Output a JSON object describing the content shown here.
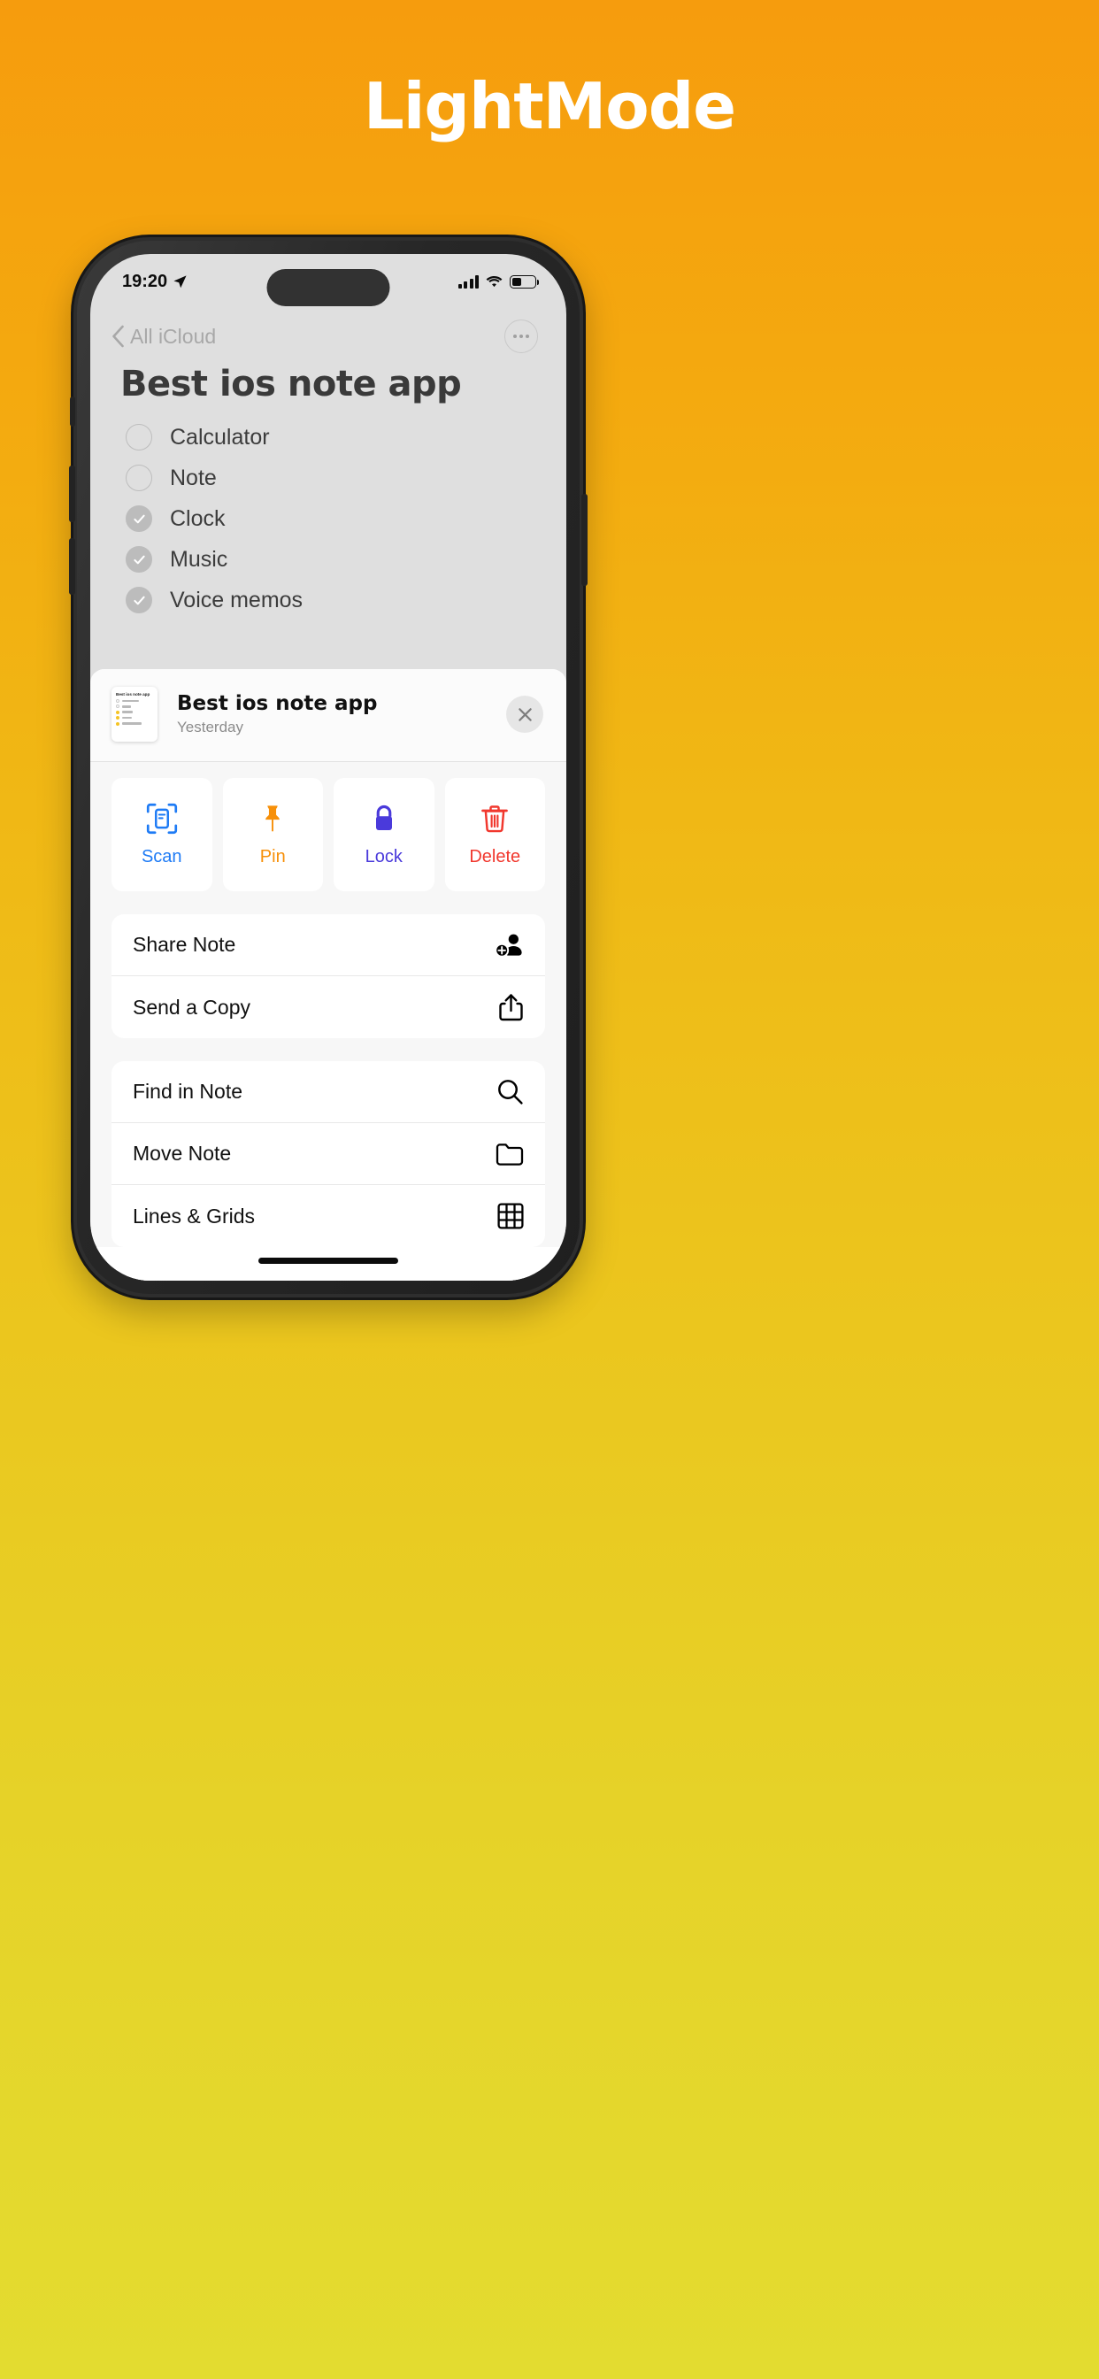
{
  "headline": "LightMode",
  "background": {
    "top_color": "#F69C0D",
    "bottom_color": "#E3DC30"
  },
  "statusbar": {
    "time": "19:20",
    "location_icon": "location-arrow-icon",
    "signal_icon": "cellular-bars-icon",
    "wifi_icon": "wifi-icon",
    "battery_icon": "battery-icon",
    "battery_level": "42%"
  },
  "navbar": {
    "back_label": "All iCloud",
    "back_icon": "chevron-left-icon",
    "more_icon": "ellipsis-circle-icon"
  },
  "note": {
    "title": "Best ios note app",
    "checklist": [
      {
        "label": "Calculator",
        "checked": false
      },
      {
        "label": "Note",
        "checked": false
      },
      {
        "label": "Clock",
        "checked": true
      },
      {
        "label": "Music",
        "checked": true
      },
      {
        "label": "Voice memos",
        "checked": true
      }
    ]
  },
  "sheet": {
    "header": {
      "title": "Best ios note app",
      "subtitle": "Yesterday",
      "thumbnail_icon": "note-thumbnail",
      "close_icon": "close-icon"
    },
    "tiles": [
      {
        "label": "Scan",
        "icon": "scan-document-icon",
        "color": "#1E7BF5"
      },
      {
        "label": "Pin",
        "icon": "pin-icon",
        "color": "#F79009"
      },
      {
        "label": "Lock",
        "icon": "lock-icon",
        "color": "#4A3ADB"
      },
      {
        "label": "Delete",
        "icon": "trash-icon",
        "color": "#F1382E"
      }
    ],
    "group_one": [
      {
        "label": "Share Note",
        "icon": "person-add-icon"
      },
      {
        "label": "Send a Copy",
        "icon": "share-icon"
      }
    ],
    "group_two": [
      {
        "label": "Find in Note",
        "icon": "search-icon"
      },
      {
        "label": "Move Note",
        "icon": "folder-icon"
      },
      {
        "label": "Lines & Grids",
        "icon": "grid-icon"
      }
    ]
  }
}
